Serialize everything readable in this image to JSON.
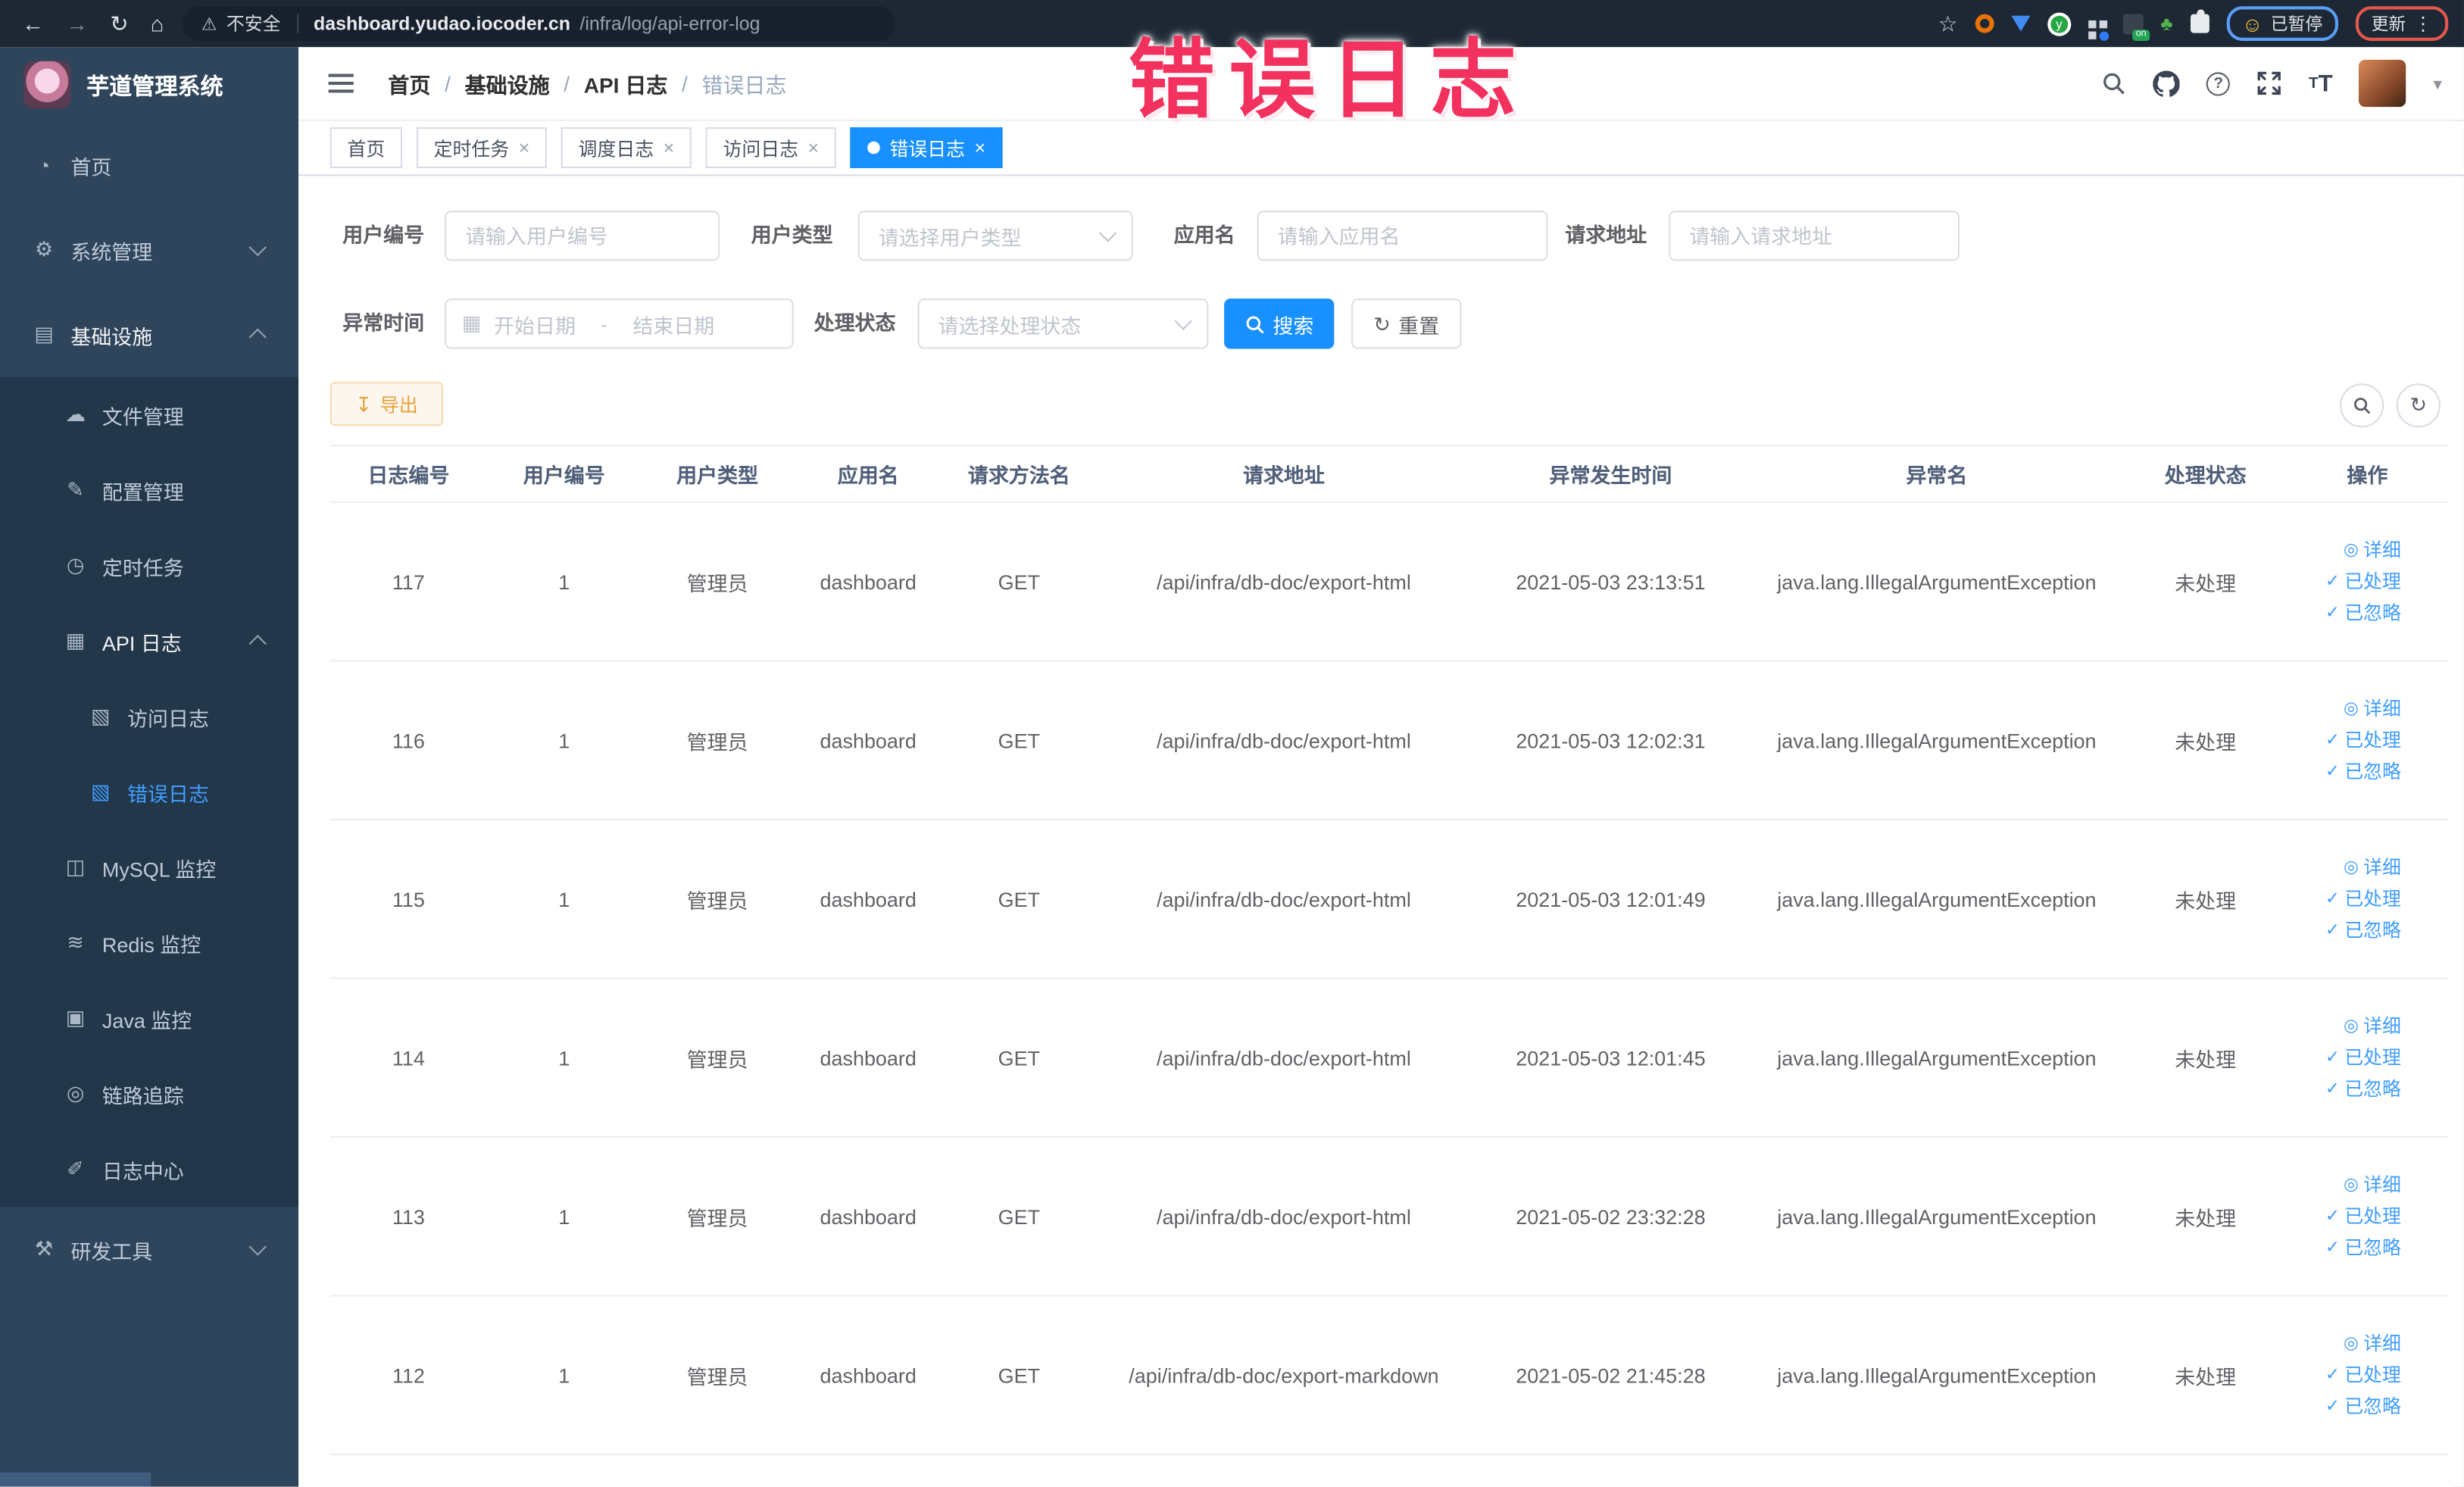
{
  "browser": {
    "security_label": "不安全",
    "url_domain": "dashboard.yudao.iocoder.cn",
    "url_path": "/infra/log/api-error-log",
    "paused_label": "已暂停",
    "update_label": "更新"
  },
  "annotation": {
    "text": "错误日志",
    "color": "#f2315e"
  },
  "icons": {
    "back": "←",
    "forward": "→",
    "reload": "↻",
    "home": "⌂",
    "warning": "⚠",
    "star": "☆",
    "kebab": "⋮",
    "caret_down": "▾",
    "calendar": "▦",
    "refresh": "↻",
    "download": "↧",
    "emoji_face": "☺",
    "ext_plant": "♣",
    "ext_y": "y"
  },
  "sidebar": {
    "title": "芋道管理系统",
    "items": [
      {
        "name": "home",
        "label": "首页",
        "glyph": "◔",
        "icon": "dashboard-icon",
        "level": 0
      },
      {
        "name": "system-management",
        "label": "系统管理",
        "glyph": "⚙",
        "icon": "gear-icon",
        "level": 0,
        "chevron": "down"
      },
      {
        "name": "infrastructure",
        "label": "基础设施",
        "glyph": "▤",
        "icon": "infrastructure-icon",
        "level": 0,
        "chevron": "up",
        "open": true
      },
      {
        "name": "file-management",
        "label": "文件管理",
        "glyph": "☁",
        "icon": "file-icon",
        "level": 1,
        "insub": true
      },
      {
        "name": "config-management",
        "label": "配置管理",
        "glyph": "✎",
        "icon": "config-icon",
        "level": 1,
        "insub": true
      },
      {
        "name": "scheduled-jobs",
        "label": "定时任务",
        "glyph": "◷",
        "icon": "timer-icon",
        "level": 1,
        "insub": true
      },
      {
        "name": "api-log",
        "label": "API 日志",
        "glyph": "▦",
        "icon": "api-log-icon",
        "level": 1,
        "insub": true,
        "chevron": "up",
        "open": true
      },
      {
        "name": "access-log",
        "label": "访问日志",
        "glyph": "▧",
        "icon": "access-log-icon",
        "level": 2,
        "insub": true
      },
      {
        "name": "error-log",
        "label": "错误日志",
        "glyph": "▧",
        "icon": "error-log-icon",
        "level": 2,
        "insub": true,
        "active": true
      },
      {
        "name": "mysql-monitor",
        "label": "MySQL 监控",
        "glyph": "◫",
        "icon": "mysql-icon",
        "level": 1,
        "insub": true
      },
      {
        "name": "redis-monitor",
        "label": "Redis 监控",
        "glyph": "≋",
        "icon": "redis-icon",
        "level": 1,
        "insub": true
      },
      {
        "name": "java-monitor",
        "label": "Java 监控",
        "glyph": "▣",
        "icon": "java-icon",
        "level": 1,
        "insub": true
      },
      {
        "name": "trace",
        "label": "链路追踪",
        "glyph": "◎",
        "icon": "trace-icon",
        "level": 1,
        "insub": true
      },
      {
        "name": "log-center",
        "label": "日志中心",
        "glyph": "✐",
        "icon": "log-center-icon",
        "level": 1,
        "insub": true
      },
      {
        "name": "dev-tools",
        "label": "研发工具",
        "glyph": "⚒",
        "icon": "devtools-icon",
        "level": 0,
        "chevron": "down"
      }
    ]
  },
  "breadcrumb": {
    "items": [
      "首页",
      "基础设施",
      "API 日志",
      "错误日志"
    ]
  },
  "tabs": [
    {
      "name": "home",
      "label": "首页",
      "closable": false,
      "active": false
    },
    {
      "name": "scheduled-jobs",
      "label": "定时任务",
      "closable": true,
      "active": false
    },
    {
      "name": "schedule-log",
      "label": "调度日志",
      "closable": true,
      "active": false
    },
    {
      "name": "access-log",
      "label": "访问日志",
      "closable": true,
      "active": false
    },
    {
      "name": "error-log",
      "label": "错误日志",
      "closable": true,
      "active": true
    }
  ],
  "filters": {
    "user_id": {
      "label": "用户编号",
      "placeholder": "请输入用户编号"
    },
    "user_type": {
      "label": "用户类型",
      "placeholder": "请选择用户类型"
    },
    "app_name": {
      "label": "应用名",
      "placeholder": "请输入应用名"
    },
    "request_url": {
      "label": "请求地址",
      "placeholder": "请输入请求地址"
    },
    "exception_time": {
      "label": "异常时间",
      "start_placeholder": "开始日期",
      "separator": "-",
      "end_placeholder": "结束日期"
    },
    "process_status": {
      "label": "处理状态",
      "placeholder": "请选择处理状态"
    },
    "search_label": "搜索",
    "reset_label": "重置"
  },
  "toolbar": {
    "export_label": "导出"
  },
  "table": {
    "columns": [
      "日志编号",
      "用户编号",
      "用户类型",
      "应用名",
      "请求方法名",
      "请求地址",
      "异常发生时间",
      "异常名",
      "处理状态",
      "操作"
    ],
    "rows": [
      {
        "id": "117",
        "user_id": "1",
        "user_type": "管理员",
        "app": "dashboard",
        "method": "GET",
        "url": "/api/infra/db-doc/export-html",
        "time": "2021-05-03 23:13:51",
        "exception": "java.lang.IllegalArgumentException",
        "status": "未处理"
      },
      {
        "id": "116",
        "user_id": "1",
        "user_type": "管理员",
        "app": "dashboard",
        "method": "GET",
        "url": "/api/infra/db-doc/export-html",
        "time": "2021-05-03 12:02:31",
        "exception": "java.lang.IllegalArgumentException",
        "status": "未处理"
      },
      {
        "id": "115",
        "user_id": "1",
        "user_type": "管理员",
        "app": "dashboard",
        "method": "GET",
        "url": "/api/infra/db-doc/export-html",
        "time": "2021-05-03 12:01:49",
        "exception": "java.lang.IllegalArgumentException",
        "status": "未处理"
      },
      {
        "id": "114",
        "user_id": "1",
        "user_type": "管理员",
        "app": "dashboard",
        "method": "GET",
        "url": "/api/infra/db-doc/export-html",
        "time": "2021-05-03 12:01:45",
        "exception": "java.lang.IllegalArgumentException",
        "status": "未处理"
      },
      {
        "id": "113",
        "user_id": "1",
        "user_type": "管理员",
        "app": "dashboard",
        "method": "GET",
        "url": "/api/infra/db-doc/export-html",
        "time": "2021-05-02 23:32:28",
        "exception": "java.lang.IllegalArgumentException",
        "status": "未处理"
      },
      {
        "id": "112",
        "user_id": "1",
        "user_type": "管理员",
        "app": "dashboard",
        "method": "GET",
        "url": "/api/infra/db-doc/export-markdown",
        "time": "2021-05-02 21:45:28",
        "exception": "java.lang.IllegalArgumentException",
        "status": "未处理"
      }
    ],
    "row_actions": [
      "详细",
      "已处理",
      "已忽略"
    ],
    "action_icons": [
      "◎",
      "✓",
      "✓"
    ],
    "action_icon_names": [
      "view-icon",
      "check-icon",
      "check-icon"
    ]
  },
  "colors": {
    "accent": "#1890ff",
    "link": "#409eff",
    "warning": "#e6a23c",
    "sidebar_bg": "#2f455c",
    "submenu_bg": "#22374a"
  }
}
